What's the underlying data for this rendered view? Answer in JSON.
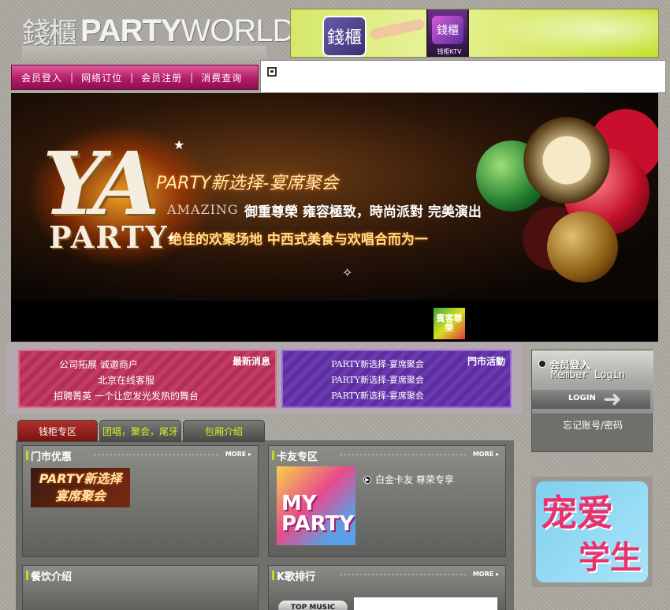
{
  "logo": {
    "cn": "錢櫃",
    "party": "PARTY",
    "world": "WORLD"
  },
  "top_ad": {
    "app_label": "錢櫃",
    "phone_app": "錢櫃",
    "phone_label": "钱柜KTV"
  },
  "nav": {
    "items": [
      "会员登入",
      "网络订位",
      "会员注册",
      "消费查询"
    ]
  },
  "hero": {
    "ya": "YA",
    "party": "PARTY",
    "tagline": "PARTY新选择-宴席聚会",
    "amazing": "AMAZING",
    "line1": "御重尊榮  雍容極致，時尚派對  完美演出",
    "line2": "绝佳的欢聚场地  中西式美食与欢唱合而为一"
  },
  "strip_icon": "賓客尊榮",
  "news": {
    "latest_title": "最新消息",
    "latest_items": [
      "公司拓展 诚邀商户",
      "北京在线客服",
      "招聘菁英 一个让您发光发热的舞台"
    ],
    "event_title": "門市活動",
    "event_items": [
      "PARTY新选择-宴席聚会",
      "PARTY新选择-宴席聚会",
      "PARTY新选择-宴席聚会"
    ]
  },
  "login": {
    "title": "会员登入",
    "subtitle": "Member Login",
    "button": "LOGIN",
    "forgot": "忘记账号/密码"
  },
  "student_ad": {
    "line1": "宠爱",
    "line2": "学生"
  },
  "tabs": [
    "钱柜专区",
    "团唱，聚会，尾牙",
    "包厢介绍"
  ],
  "sections": {
    "store": {
      "title": "门市优惠",
      "more": "MORE ▸",
      "coupon_line1": "PARTY新选择",
      "coupon_line2": "宴席聚会"
    },
    "card": {
      "title": "卡友专区",
      "more": "MORE ▸",
      "image_text": "MY PARTY",
      "item": "白金卡友 尊荣专享"
    },
    "food": {
      "title": "餐饮介绍"
    },
    "ktv": {
      "title": "K歌排行",
      "more": "MORE ▸",
      "badge": "TOP MUSIC"
    }
  },
  "colors": {
    "nav_pink": "#b31c68",
    "news_pink": "#c23c64",
    "news_purple": "#6a3ab0",
    "accent_green": "#b8e020"
  }
}
